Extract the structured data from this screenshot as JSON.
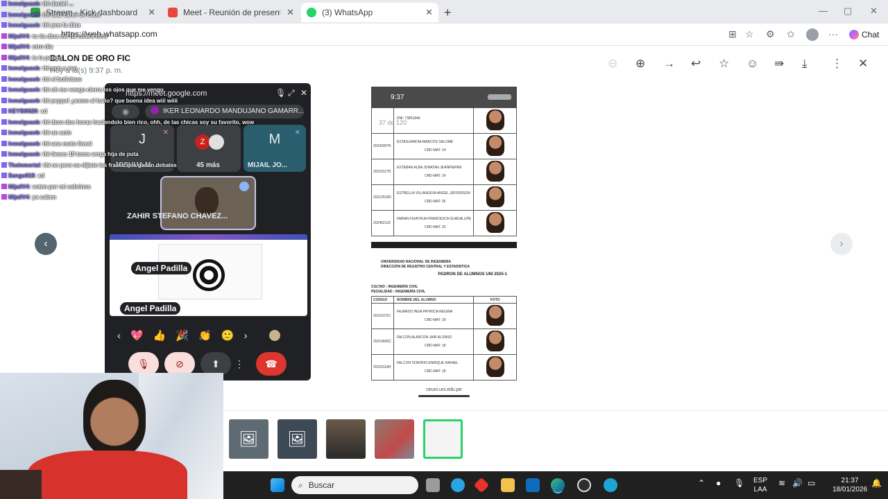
{
  "browser": {
    "tabs": [
      {
        "title": "Streem - Kick dashboard",
        "color": "#2f9e44"
      },
      {
        "title": "Meet - Reunión de presentació",
        "color": "#e8453c"
      },
      {
        "title": "(3) WhatsApp",
        "color": "#25d366"
      }
    ],
    "url": "https://web.whatsapp.com",
    "chat_label": "Chat"
  },
  "viewer": {
    "title": "BALON DE ORO FIC",
    "subtitle": "Hoy a la(s) 9:37 p. m.",
    "page_counter": "37 de 120"
  },
  "phone": {
    "time": "9:37",
    "rows_top": [
      {
        "code": "",
        "name": "DNI: 73851849",
        "sub": ""
      },
      {
        "code": "2024205?K",
        "name": "ESTAGUARDIA-MARCOS SALOME",
        "sub": "CRD-MAT: 14"
      },
      {
        "code": "2021011?D",
        "name": "ESTEBAN ALBA JONATAN JEANPIERRE",
        "sub": "CRD-MAT: 14"
      },
      {
        "code": "20212510D",
        "name": "ESTRELLA VILLANUEVA ANGEL JEFFERSON",
        "sub": "CRD-MAT: 26"
      },
      {
        "code": "20240211K",
        "name": "FABIAN HUAYHUA FRANCESCA GUADALUPE",
        "sub": "CRD-MAT: 20"
      }
    ],
    "doc2": {
      "uni": "UNIVERSIDAD NACIONAL DE INGENIERIA",
      "dir": "DIRECCIÓN DE REGISTRO CENTRAL Y ESTADISTICA",
      "padron": "PADRON DE ALUMNOS UNI 2025-1",
      "facultad": "CULTAD : INGENIERÍA CIVIL",
      "especialidad": "PECIALIDAD : INGENIERÍA CIVIL",
      "col_codigo": "CODIGO",
      "col_nombre": "NOMBRE DEL ALUMNO",
      "col_foto": "FOTO",
      "rows": [
        {
          "code": "20151075J",
          "name": "FAJARDO INGA PATRICIA REGINA",
          "sub": "CRD-MAT: 18"
        },
        {
          "code": "20210600C",
          "name": "FALCON ALARCON JAIR ALONSO",
          "sub": "CRD-MAT: 18"
        },
        {
          "code": "20220118H",
          "name": "FALCON TENORIO ENRIQUE RAFAEL",
          "sub": "CRD-MAT: 18"
        }
      ]
    },
    "footer_url": "ceuni.uni.edu.pe"
  },
  "meet": {
    "url": "https://meet.google.com",
    "pinned_name": "IKER LEONARDO MANDUJANO GAMARR...",
    "pinned_initial": "I",
    "tiles": [
      {
        "initial": "J",
        "label": "JOSHUA M..."
      },
      {
        "initial": "Z",
        "label": "45 más"
      },
      {
        "initial": "M",
        "label": "MIJAIL JO..."
      }
    ],
    "self_label": "ZAHIR STEFANO CHAVEZ...",
    "presenter_chip": "Angel Padilla",
    "presenter_chip2": "Angel Padilla",
    "reactions": [
      "‹",
      "💖",
      "👍",
      "🎉",
      "👏",
      "🙂",
      "›"
    ]
  },
  "chat": [
    {
      "user": "Inmolguaeb",
      "msg": ": thi daniel ..."
    },
    {
      "user": "Inmolguaeb",
      "msg": ": thi diaz canel de cuba"
    },
    {
      "user": "Inmolguaeb",
      "msg": ": thi pon la dina"
    },
    {
      "user": "MijailV4",
      "msg": ": tu tia dina me da colera mno",
      "p": true
    },
    {
      "user": "MijailV4",
      "msg": ": otro dia",
      "p": true
    },
    {
      "user": "MijailV4",
      "msg": ": te la pongo",
      "p": true
    },
    {
      "user": "Inmolguaeb",
      "msg": ": thi pon a evo"
    },
    {
      "user": "Inmolguaeb",
      "msg": ": thi el boliviano"
    },
    {
      "user": "Inmolguaeb",
      "msg": ": thi oh me vengo cierra los ojos que me vengo"
    },
    {
      "user": "Inmolguaeb",
      "msg": ": thi peppa! ¿vamo al baño? que buena idea wiii wiiii"
    },
    {
      "user": "KEYSI0620",
      "msg": ": xd"
    },
    {
      "user": "Inmolguaeb",
      "msg": ": thi duro dos horas haciendolo bien rico, ohh, de las chicas soy su favorito, wow"
    },
    {
      "user": "Inmolguaeb",
      "msg": ": thi un auto"
    },
    {
      "user": "Inmolguaeb",
      "msg": ": thi una moto lineal"
    },
    {
      "user": "Inmolguaeb",
      "msg": ": thi tienes 19 toma verga hija de puta"
    },
    {
      "user": "Theinmortal",
      "msg": ": thi oe pero no dijiste las frases que ganan debates"
    },
    {
      "user": "Sangu019",
      "msg": ": xd"
    },
    {
      "user": "MijailV4",
      "msg": ": voten por mi sobrinos",
      "p": true
    },
    {
      "user": "MijailV4",
      "msg": ": ya saben",
      "p": true
    }
  ],
  "taskbar": {
    "search_placeholder": "Buscar",
    "lang_top": "ESP",
    "lang_bottom": "LAA",
    "time": "21:37",
    "date": "18/01/2026"
  }
}
